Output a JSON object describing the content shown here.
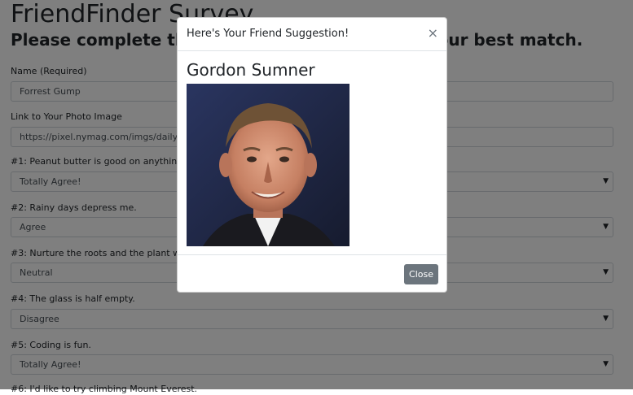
{
  "page": {
    "title": "FriendFinder Survey",
    "subtitle": "Please complete the following survey to find your best match.",
    "fields": [
      {
        "label": "Name (Required)",
        "value": "Forrest Gump"
      },
      {
        "label": "Link to Your Photo Image",
        "value": "https://pixel.nymag.com/imgs/daily/vulture"
      }
    ],
    "questions": [
      {
        "label": "#1: Peanut butter is good on anything.",
        "value": "Totally Agree!"
      },
      {
        "label": "#2: Rainy days depress me.",
        "value": "Agree"
      },
      {
        "label": "#3: Nurture the roots and the plant will grow.",
        "value": "Neutral"
      },
      {
        "label": "#4: The glass is half empty.",
        "value": "Disagree"
      },
      {
        "label": "#5: Coding is fun.",
        "value": "Totally Agree!"
      },
      {
        "label": "#6: I'd like to try climbing Mount Everest."
      }
    ]
  },
  "modal": {
    "title": "Here's Your Friend Suggestion!",
    "close_icon": "×",
    "friend_name": "Gordon Sumner",
    "photo_alt": "portrait-photo",
    "close_label": "Close"
  },
  "colors": {
    "overlay": "#000000",
    "close_button": "#6c757d"
  }
}
